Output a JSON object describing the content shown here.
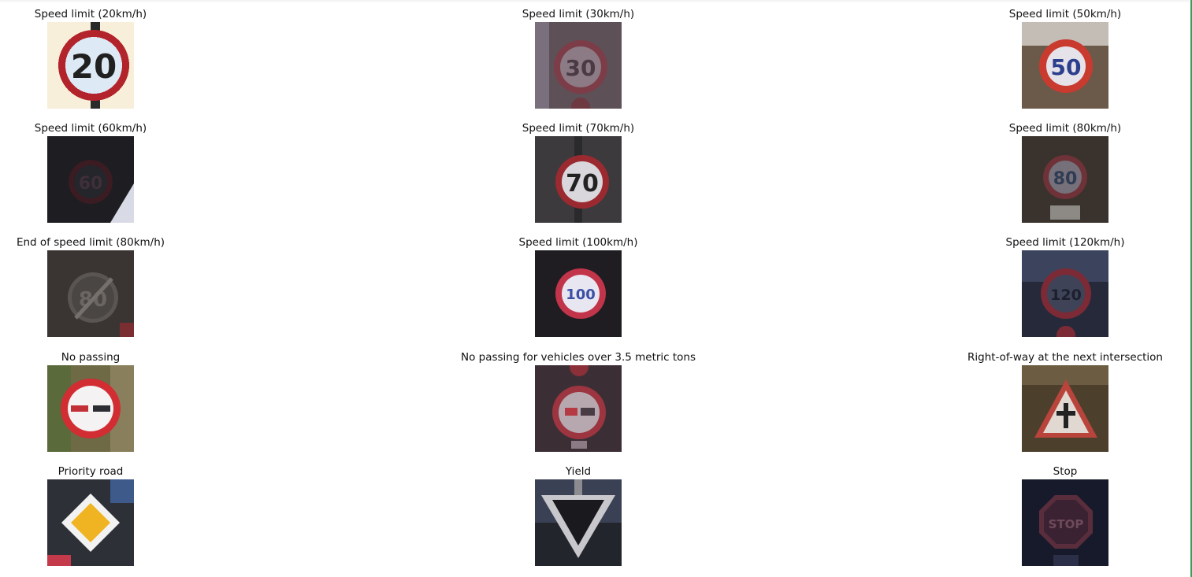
{
  "figure": {
    "panels": [
      {
        "title": "Speed limit (20km/h)",
        "sign_label": "20",
        "sign_icon": "speed-limit-20-sign"
      },
      {
        "title": "Speed limit (30km/h)",
        "sign_label": "30",
        "sign_icon": "speed-limit-30-sign"
      },
      {
        "title": "Speed limit (50km/h)",
        "sign_label": "50",
        "sign_icon": "speed-limit-50-sign"
      },
      {
        "title": "Speed limit (60km/h)",
        "sign_label": "60",
        "sign_icon": "speed-limit-60-sign"
      },
      {
        "title": "Speed limit (70km/h)",
        "sign_label": "70",
        "sign_icon": "speed-limit-70-sign"
      },
      {
        "title": "Speed limit (80km/h)",
        "sign_label": "80",
        "sign_icon": "speed-limit-80-sign"
      },
      {
        "title": "End of speed limit (80km/h)",
        "sign_label": "80",
        "sign_icon": "end-speed-limit-80-sign"
      },
      {
        "title": "Speed limit (100km/h)",
        "sign_label": "100",
        "sign_icon": "speed-limit-100-sign"
      },
      {
        "title": "Speed limit (120km/h)",
        "sign_label": "120",
        "sign_icon": "speed-limit-120-sign"
      },
      {
        "title": "No passing",
        "sign_label": "",
        "sign_icon": "no-passing-sign"
      },
      {
        "title": "No passing for vehicles over 3.5 metric tons",
        "sign_label": "",
        "sign_icon": "no-passing-trucks-sign"
      },
      {
        "title": "Right-of-way at the next intersection",
        "sign_label": "",
        "sign_icon": "right-of-way-sign"
      },
      {
        "title": "Priority road",
        "sign_label": "",
        "sign_icon": "priority-road-sign"
      },
      {
        "title": "Yield",
        "sign_label": "",
        "sign_icon": "yield-sign"
      },
      {
        "title": "Stop",
        "sign_label": "STOP",
        "sign_icon": "stop-sign"
      }
    ]
  }
}
